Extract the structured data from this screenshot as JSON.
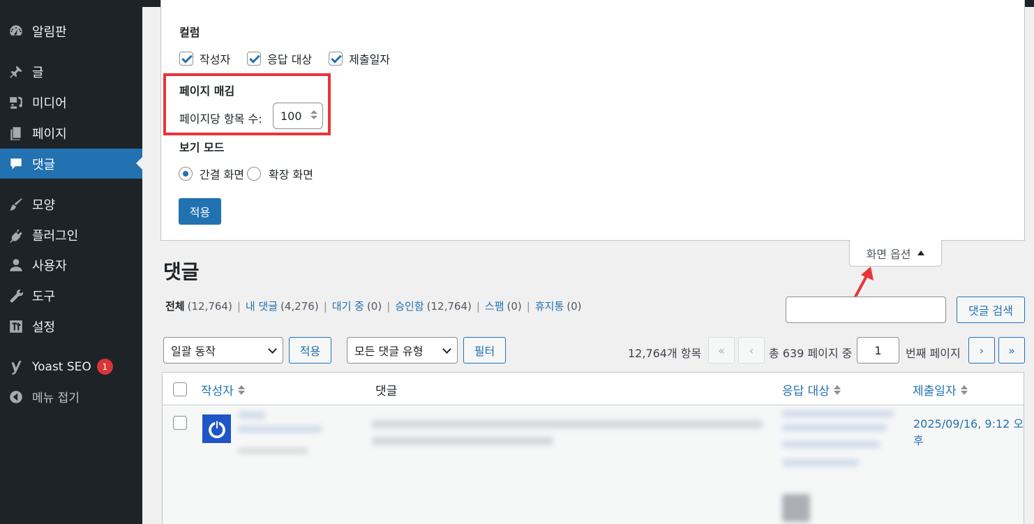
{
  "sidebar": {
    "items": [
      {
        "label": "알림판",
        "icon": "dashboard-icon"
      },
      {
        "label": "글",
        "icon": "pin-icon"
      },
      {
        "label": "미디어",
        "icon": "media-icon"
      },
      {
        "label": "페이지",
        "icon": "pages-icon"
      },
      {
        "label": "댓글",
        "icon": "comment-icon",
        "active": true
      },
      {
        "label": "모양",
        "icon": "brush-icon"
      },
      {
        "label": "플러그인",
        "icon": "plugin-icon"
      },
      {
        "label": "사용자",
        "icon": "user-icon"
      },
      {
        "label": "도구",
        "icon": "wrench-icon"
      },
      {
        "label": "설정",
        "icon": "settings-icon"
      },
      {
        "label": "Yoast SEO",
        "icon": "yoast-icon",
        "badge": "1"
      },
      {
        "label": "메뉴 접기",
        "icon": "collapse-icon"
      }
    ]
  },
  "screen_options": {
    "columns_heading": "컬럼",
    "columns": [
      {
        "label": "작성자",
        "checked": true
      },
      {
        "label": "응답 대상",
        "checked": true
      },
      {
        "label": "제출일자",
        "checked": true
      }
    ],
    "pagination_heading": "페이지 매김",
    "per_page_label": "페이지당 항목 수:",
    "per_page_value": "100",
    "view_mode_heading": "보기 모드",
    "view_modes": [
      {
        "label": "간결 화면",
        "checked": true
      },
      {
        "label": "확장 화면",
        "checked": false
      }
    ],
    "apply_label": "적용",
    "toggle_label": "화면 옵션"
  },
  "page": {
    "title": "댓글",
    "filters": [
      {
        "label": "전체",
        "count": "(12,764)",
        "current": true
      },
      {
        "label": "내 댓글",
        "count": "(4,276)"
      },
      {
        "label": "대기 중",
        "count": "(0)"
      },
      {
        "label": "승인함",
        "count": "(12,764)"
      },
      {
        "label": "스팸",
        "count": "(0)"
      },
      {
        "label": "휴지통",
        "count": "(0)"
      }
    ],
    "search_button": "댓글 검색",
    "search_value": ""
  },
  "toolbar": {
    "bulk_action": "일괄 동작",
    "bulk_apply": "적용",
    "comment_type": "모든 댓글 유형",
    "filter": "필터",
    "item_count": "12,764개 항목",
    "first": "«",
    "prev": "‹",
    "total_pages_prefix": "총 639 페이지 중",
    "current_page": "1",
    "page_suffix": "번째 페이지",
    "next": "›",
    "last": "»"
  },
  "table": {
    "columns": [
      "작성자",
      "댓글",
      "응답 대상",
      "제출일자"
    ],
    "rows": [
      {
        "date": "2025/09/16, 9:12 오후"
      }
    ]
  },
  "colors": {
    "sidebar_bg": "#1d2327",
    "accent": "#2271b1",
    "highlight_box": "#e8353a",
    "badge": "#d63638"
  }
}
